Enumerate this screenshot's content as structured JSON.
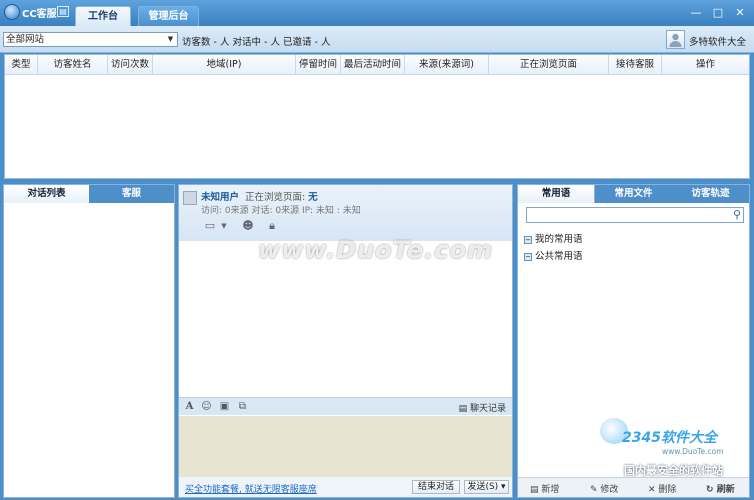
{
  "app": {
    "title": "CC客服",
    "menu_icon": "▤"
  },
  "tabs": [
    {
      "label": "工作台"
    },
    {
      "label": "管理后台"
    }
  ],
  "window_controls": {
    "min": "—",
    "max": "□",
    "close": "✕"
  },
  "toolbar": {
    "site": "全部网站",
    "stats": "访客数 - 人  对话中 - 人  已邀请 - 人",
    "username": "多特软件大全"
  },
  "grid": {
    "columns": [
      "类型",
      "访客姓名",
      "访问次数",
      "地域(IP)",
      "停留时间",
      "最后活动时间",
      "来源(来源词)",
      "正在浏览页面",
      "接待客服",
      "操作"
    ]
  },
  "left": {
    "tabs": [
      "对话列表",
      "客服"
    ]
  },
  "chat": {
    "user": "未知用户",
    "viewing_label": "正在浏览页面: ",
    "viewing_value": "无",
    "info": "访问: 0来源 对话: 0来源 IP: 未知 : 未知",
    "history": "聊天记录",
    "promo": "买全功能套餐, 就送无限客服座席",
    "end_btn": "结束对话",
    "send_btn": "发送(S) ▾"
  },
  "right": {
    "tabs": [
      "常用语",
      "常用文件",
      "访客轨迹"
    ],
    "items": [
      "我的常用语",
      "公共常用语"
    ],
    "footer": [
      "新增",
      "修改",
      "删除",
      "刷新"
    ]
  },
  "watermark": {
    "main": "www.DuoTe.com",
    "brand": "2345软件大全",
    "url": "www.DuoTe.com",
    "slogan": "国内最安全的软件站"
  },
  "colors": {
    "accent": "#4a8fc9",
    "link": "#1a6ac0"
  }
}
